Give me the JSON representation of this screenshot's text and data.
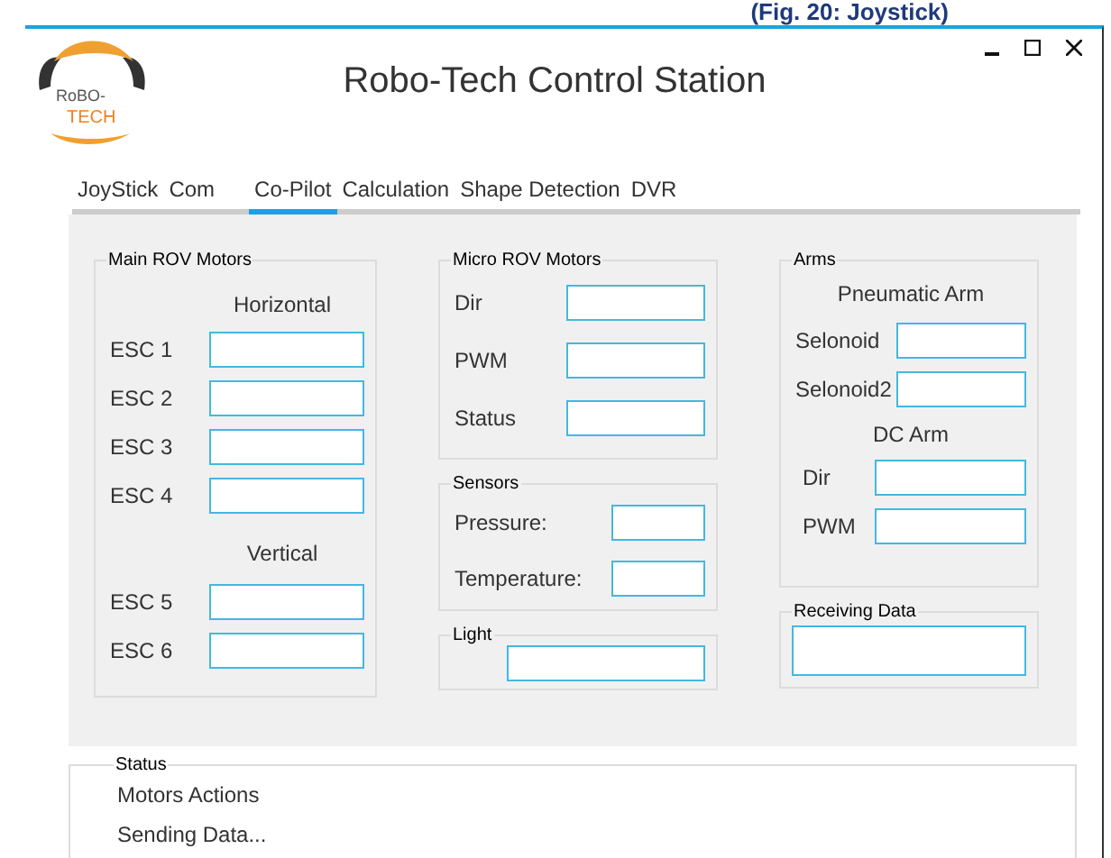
{
  "caption": "(Fig. 20: Joystick)",
  "window": {
    "title": "Robo-Tech Control Station",
    "logo_text": [
      "RoBO-",
      "TECH"
    ]
  },
  "tabs": [
    {
      "label": "JoyStick",
      "selected": false
    },
    {
      "label": "Com",
      "selected": false
    },
    {
      "label": "Co-Pilot",
      "selected": true
    },
    {
      "label": "Calculation",
      "selected": false
    },
    {
      "label": "Shape Detection",
      "selected": false
    },
    {
      "label": "DVR",
      "selected": false
    }
  ],
  "main_motors": {
    "title": "Main ROV Motors",
    "sections": [
      {
        "heading": "Horizontal",
        "fields": [
          "ESC 1",
          "ESC 2",
          "ESC 3",
          "ESC 4"
        ]
      },
      {
        "heading": "Vertical",
        "fields": [
          "ESC 5",
          "ESC 6"
        ]
      }
    ]
  },
  "micro_motors": {
    "title": "Micro ROV Motors",
    "fields": [
      "Dir",
      "PWM",
      "Status"
    ]
  },
  "sensors": {
    "title": "Sensors",
    "fields": [
      "Pressure:",
      "Temperature:"
    ]
  },
  "light": {
    "title": "Light"
  },
  "arms": {
    "title": "Arms",
    "sections": [
      {
        "heading": "Pneumatic Arm",
        "fields": [
          "Selonoid",
          "Selonoid2"
        ]
      },
      {
        "heading": "DC Arm",
        "fields": [
          "Dir",
          "PWM"
        ]
      }
    ]
  },
  "receiving": {
    "title": "Receiving Data"
  },
  "status": {
    "title": "Status",
    "lines": [
      "Motors Actions",
      "Sending Data..."
    ]
  }
}
